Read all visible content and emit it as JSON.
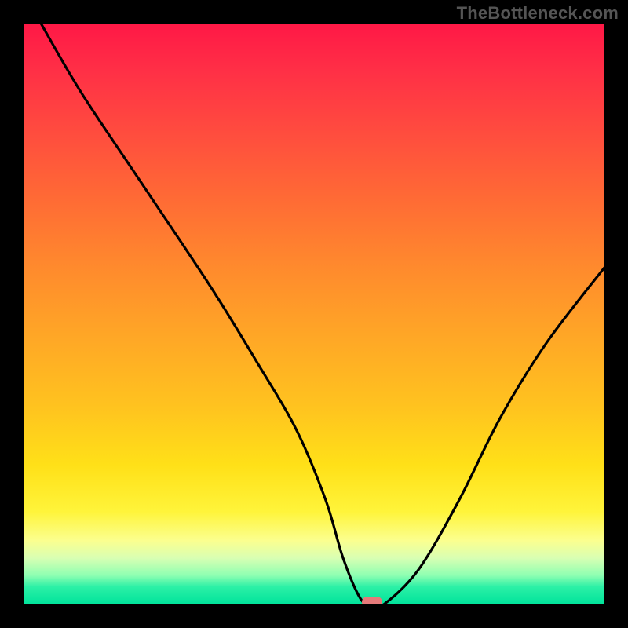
{
  "watermark": "TheBottleneck.com",
  "chart_data": {
    "type": "line",
    "title": "",
    "xlabel": "",
    "ylabel": "",
    "xlim": [
      0,
      100
    ],
    "ylim": [
      0,
      100
    ],
    "grid": false,
    "series": [
      {
        "name": "curve",
        "x": [
          3,
          10,
          20,
          32,
          40,
          47,
          52,
          55,
          58,
          60,
          62,
          68,
          75,
          82,
          90,
          100
        ],
        "y": [
          100,
          88,
          73,
          55,
          42,
          30,
          18,
          8,
          1,
          0,
          0,
          6,
          18,
          32,
          45,
          58
        ]
      }
    ],
    "marker": {
      "x": 60,
      "y": 0,
      "color": "#e57a7a"
    },
    "background_gradient": {
      "top": "#ff1846",
      "mid": "#ffc31f",
      "bottom": "#00e39b"
    },
    "frame_color": "#000000"
  }
}
